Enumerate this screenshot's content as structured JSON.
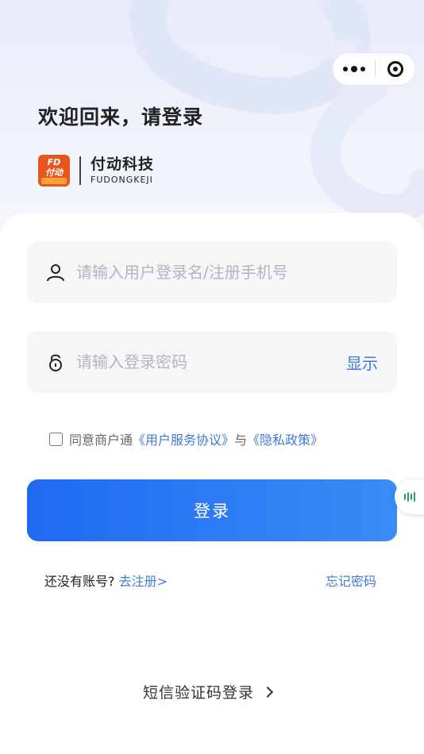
{
  "capsule": {
    "more_icon": "ellipsis-icon",
    "close_icon": "target-icon"
  },
  "header": {
    "welcome": "欢迎回来，请登录",
    "brand_name": "付动科技",
    "brand_en": "FUDONGKEJI",
    "logo_icon": "fudong-logo"
  },
  "form": {
    "username_placeholder": "请输入用户登录名/注册手机号",
    "password_placeholder": "请输入登录密码",
    "show_label": "显示",
    "agree_prefix": "同意商户通",
    "agree_terms": "《用户服务协议》",
    "agree_and": "与",
    "agree_privacy": "《隐私政策》",
    "login_label": "登录"
  },
  "footer": {
    "no_account": "还没有账号?",
    "register": "去注册>",
    "forgot": "忘记密码",
    "sms_login": "短信验证码登录"
  },
  "colors": {
    "primary": "#1f6af2",
    "link": "#3f7bd6",
    "brand": "#e8551f"
  }
}
